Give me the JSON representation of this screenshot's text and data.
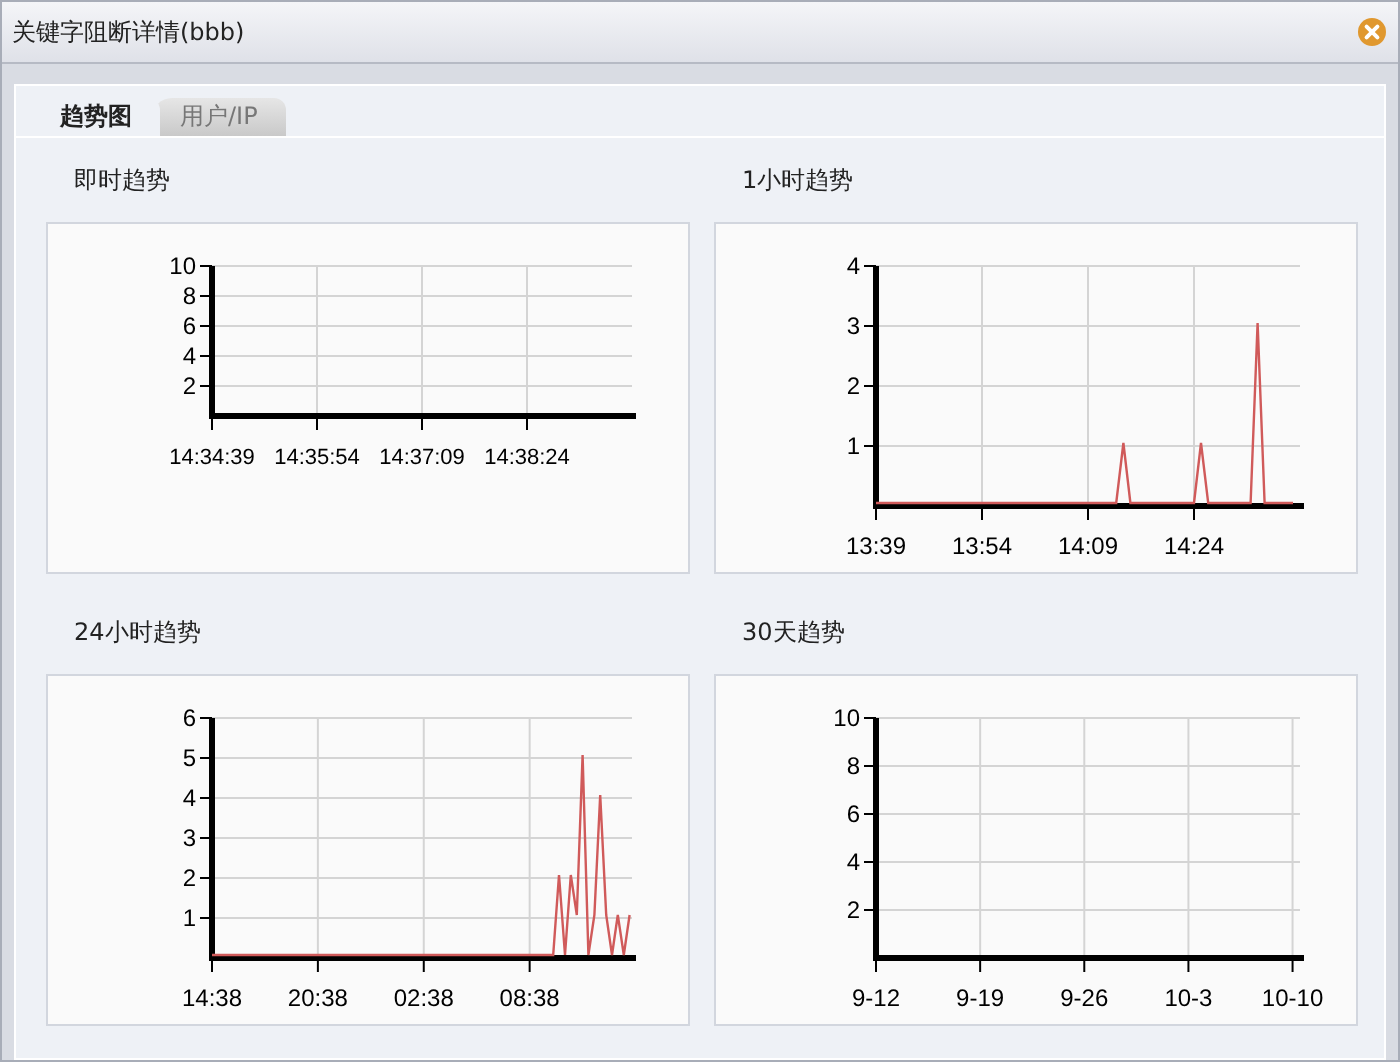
{
  "window": {
    "title": "关键字阻断详情(bbb)"
  },
  "tabs": [
    {
      "label": "趋势图",
      "selected": true
    },
    {
      "label": "用户/IP",
      "selected": false
    }
  ],
  "panels": [
    {
      "title": "即时趋势",
      "chart_data": {
        "type": "line",
        "grid": true,
        "ylim": [
          0,
          10
        ],
        "yticks": [
          2,
          4,
          6,
          8,
          10
        ],
        "categories": [
          "14:34:39",
          "14:35:54",
          "14:37:09",
          "14:38:24",
          null
        ]
      }
    },
    {
      "title": "1小时趋势",
      "chart_data": {
        "type": "line",
        "grid": true,
        "ylim": [
          0,
          4
        ],
        "yticks": [
          1,
          2,
          3,
          4
        ],
        "categories": [
          "13:39",
          null,
          null,
          null,
          null,
          null,
          null,
          null,
          null,
          null,
          null,
          null,
          null,
          null,
          null,
          "13:54",
          null,
          null,
          null,
          null,
          null,
          null,
          null,
          null,
          null,
          null,
          null,
          null,
          null,
          null,
          "14:09",
          null,
          null,
          null,
          null,
          null,
          null,
          null,
          null,
          null,
          null,
          null,
          null,
          null,
          null,
          "14:24",
          null,
          null,
          null,
          null,
          null,
          null,
          null,
          null,
          null,
          null,
          null,
          null,
          null,
          null
        ],
        "series": [
          {
            "color": "#d05a5a",
            "values": [
              0,
              0,
              0,
              0,
              0,
              0,
              0,
              0,
              0,
              0,
              0,
              0,
              0,
              0,
              0,
              0,
              0,
              0,
              0,
              0,
              0,
              0,
              0,
              0,
              0,
              0,
              0,
              0,
              0,
              0,
              0,
              0,
              0,
              0,
              0,
              1,
              0,
              0,
              0,
              0,
              0,
              0,
              0,
              0,
              0,
              0,
              1,
              0,
              0,
              0,
              0,
              0,
              0,
              0,
              3,
              0,
              0,
              0,
              0,
              0
            ]
          }
        ]
      }
    },
    {
      "title": "24小时趋势",
      "chart_data": {
        "type": "line",
        "grid": true,
        "ylim": [
          0,
          6
        ],
        "yticks": [
          1,
          2,
          3,
          4,
          5,
          6
        ],
        "categories": [
          "14:38",
          null,
          null,
          null,
          null,
          null,
          null,
          null,
          null,
          null,
          null,
          null,
          null,
          null,
          null,
          null,
          null,
          null,
          "20:38",
          null,
          null,
          null,
          null,
          null,
          null,
          null,
          null,
          null,
          null,
          null,
          null,
          null,
          null,
          null,
          null,
          null,
          "02:38",
          null,
          null,
          null,
          null,
          null,
          null,
          null,
          null,
          null,
          null,
          null,
          null,
          null,
          null,
          null,
          null,
          null,
          "08:38",
          null,
          null,
          null,
          null,
          null,
          null,
          null,
          null,
          null,
          null,
          null,
          null,
          null,
          null,
          null,
          null,
          null
        ],
        "series": [
          {
            "color": "#d05a5a",
            "values": [
              0,
              0,
              0,
              0,
              0,
              0,
              0,
              0,
              0,
              0,
              0,
              0,
              0,
              0,
              0,
              0,
              0,
              0,
              0,
              0,
              0,
              0,
              0,
              0,
              0,
              0,
              0,
              0,
              0,
              0,
              0,
              0,
              0,
              0,
              0,
              0,
              0,
              0,
              0,
              0,
              0,
              0,
              0,
              0,
              0,
              0,
              0,
              0,
              0,
              0,
              0,
              0,
              0,
              0,
              0,
              0,
              0,
              0,
              0,
              2,
              0,
              2,
              1,
              5,
              0,
              1,
              4,
              1,
              0,
              1,
              0,
              1
            ]
          }
        ]
      }
    },
    {
      "title": "30天趋势",
      "chart_data": {
        "type": "line",
        "grid": true,
        "ylim": [
          0,
          10
        ],
        "yticks": [
          2,
          4,
          6,
          8,
          10
        ],
        "categories": [
          "9-12",
          null,
          null,
          null,
          null,
          null,
          null,
          "9-19",
          null,
          null,
          null,
          null,
          null,
          null,
          "9-26",
          null,
          null,
          null,
          null,
          null,
          null,
          "10-3",
          null,
          null,
          null,
          null,
          null,
          null,
          "10-10"
        ]
      }
    }
  ]
}
